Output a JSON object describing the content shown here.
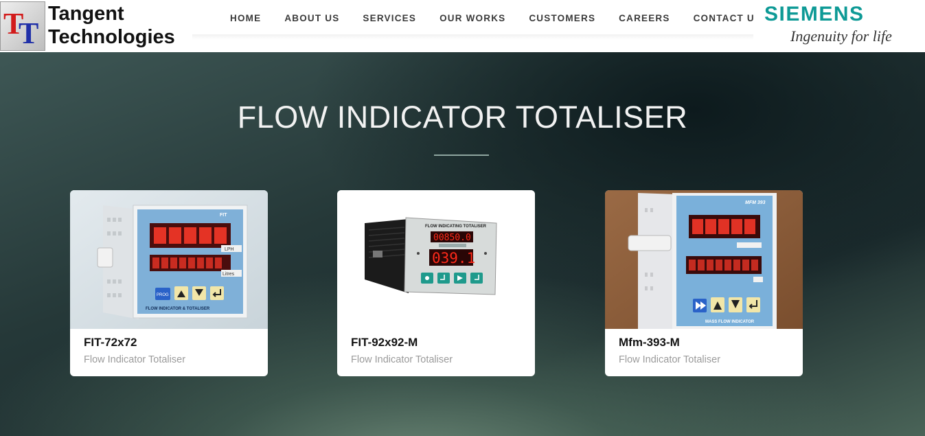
{
  "brand": {
    "logo_initials": "TT",
    "name_line1": "Tangent",
    "name_line2": "Technologies",
    "colors": {
      "red": "#d21b1b",
      "blue": "#2030a8"
    }
  },
  "nav": {
    "items": [
      {
        "label": "HOME"
      },
      {
        "label": "ABOUT US"
      },
      {
        "label": "SERVICES"
      },
      {
        "label": "OUR WORKS"
      },
      {
        "label": "CUSTOMERS"
      },
      {
        "label": "CAREERS"
      },
      {
        "label": "CONTACT US"
      }
    ]
  },
  "partner": {
    "name": "SIEMENS",
    "tagline": "Ingenuity for life",
    "color": "#0e9a96"
  },
  "page": {
    "title": "FLOW INDICATOR TOTALISER"
  },
  "products": [
    {
      "title": "FIT-72x72",
      "subtitle": "Flow Indicator Totaliser",
      "image": "fit-72x72-device-image"
    },
    {
      "title": "FIT-92x92-M",
      "subtitle": "Flow Indicator Totaliser",
      "image": "fit-92x92-m-device-image",
      "display_top": "00850.0",
      "display_bottom": "039.1",
      "panel_label": "FLOW INDICATING TOTALISER"
    },
    {
      "title": "Mfm-393-M",
      "subtitle": "Flow Indicator Totaliser",
      "image": "mfm-393-m-device-image",
      "panel_label": "MFM 393",
      "footer_label": "MASS FLOW INDICATOR"
    }
  ],
  "device1": {
    "top_label": "FIT",
    "unit1": "LPH",
    "unit2": "Litres",
    "prog": "PROG",
    "footer": "FLOW INDICATOR & TOTALISER"
  }
}
